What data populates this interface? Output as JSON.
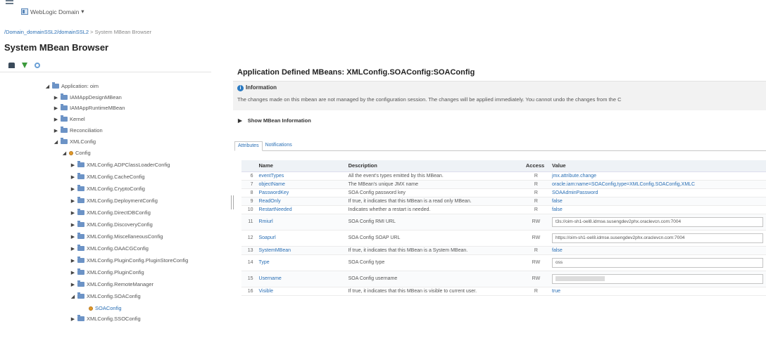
{
  "header": {
    "domain_menu": "WebLogic Domain",
    "domain_caret": "▾",
    "breadcrumb_link": "/Domain_domainSSL2/domainSSL2",
    "breadcrumb_current": " > System MBean Browser",
    "page_title": "System MBean Browser"
  },
  "tree": [
    {
      "label": "Application: oim",
      "toggle": "◢",
      "kind": "folder"
    },
    {
      "label": "IAMAppDesignMBean",
      "toggle": "▶",
      "kind": "folder"
    },
    {
      "label": "IAMAppRuntimeMBean",
      "toggle": "▶",
      "kind": "folder"
    },
    {
      "label": "Kernel",
      "toggle": "▶",
      "kind": "folder"
    },
    {
      "label": "Reconciliation",
      "toggle": "▶",
      "kind": "folder"
    },
    {
      "label": "XMLConfig",
      "toggle": "◢",
      "kind": "folder"
    },
    {
      "label": "Config",
      "toggle": "◢",
      "kind": "bean"
    },
    {
      "label": "XMLConfig.ADPClassLoaderConfig",
      "toggle": "▶",
      "kind": "folder"
    },
    {
      "label": "XMLConfig.CacheConfig",
      "toggle": "▶",
      "kind": "folder"
    },
    {
      "label": "XMLConfig.CryptoConfig",
      "toggle": "▶",
      "kind": "folder"
    },
    {
      "label": "XMLConfig.DeploymentConfig",
      "toggle": "▶",
      "kind": "folder"
    },
    {
      "label": "XMLConfig.DirectDBConfig",
      "toggle": "▶",
      "kind": "folder"
    },
    {
      "label": "XMLConfig.DiscoveryConfig",
      "toggle": "▶",
      "kind": "folder"
    },
    {
      "label": "XMLConfig.MiscellaneousConfig",
      "toggle": "▶",
      "kind": "folder"
    },
    {
      "label": "XMLConfig.OAACGConfig",
      "toggle": "▶",
      "kind": "folder"
    },
    {
      "label": "XMLConfig.PluginConfig.PluginStoreConfig",
      "toggle": "▶",
      "kind": "folder"
    },
    {
      "label": "XMLConfig.PluginConfig",
      "toggle": "▶",
      "kind": "folder"
    },
    {
      "label": "XMLConfig.RemoteManager",
      "toggle": "▶",
      "kind": "folder"
    },
    {
      "label": "XMLConfig.SOAConfig",
      "toggle": "◢",
      "kind": "folder"
    },
    {
      "label": "SOAConfig",
      "toggle": "",
      "kind": "bean"
    },
    {
      "label": "XMLConfig.SSOConfig",
      "toggle": "▶",
      "kind": "folder"
    }
  ],
  "main": {
    "title": "Application Defined MBeans: XMLConfig.SOAConfig:SOAConfig",
    "info_label": "Information",
    "info_icon": "i",
    "info_message": "The changes made on this mbean are not managed by the configuration session. The changes will be applied immediately. You cannot undo the changes from the C",
    "show_info_toggle": "▶",
    "show_info_label": "Show MBean Information",
    "tabs": [
      "Attributes",
      "Notifications"
    ]
  },
  "table": {
    "headers": [
      "",
      "Name",
      "Description",
      "Access",
      "Value"
    ],
    "rows": [
      {
        "num": "6",
        "name": "eventTypes",
        "desc": "All the event's types emitted by this MBean.",
        "access": "R",
        "value": "jmx.attribute.change",
        "editable": false
      },
      {
        "num": "7",
        "name": "objectName",
        "desc": "The MBean's unique JMX name",
        "access": "R",
        "value": "oracle.iam:name=SOAConfig,type=XMLConfig.SOAConfig,XMLC",
        "editable": false
      },
      {
        "num": "8",
        "name": "PasswordKey",
        "desc": "SOA Config password key",
        "access": "R",
        "value": "SOAAdminPassword",
        "editable": false
      },
      {
        "num": "9",
        "name": "ReadOnly",
        "desc": "If true, it indicates that this MBean is a read only MBean.",
        "access": "R",
        "value": "false",
        "editable": false
      },
      {
        "num": "10",
        "name": "RestartNeeded",
        "desc": "Indicates whether a restart is needed.",
        "access": "R",
        "value": "false",
        "editable": false
      },
      {
        "num": "11",
        "name": "Rmiurl",
        "desc": "SOA Config RMI URL",
        "access": "RW",
        "value": "t3s://oim-sh1-oel8.idmse.susengdev2phx.oraclevcn.com:7004",
        "editable": true
      },
      {
        "num": "12",
        "name": "Soapurl",
        "desc": "SOA Config SOAP URL",
        "access": "RW",
        "value": "https://oim-sh1-oel8.idmse.susengdev2phx.oraclevcn.com:7004",
        "editable": true
      },
      {
        "num": "13",
        "name": "SystemMBean",
        "desc": "If true, it indicates that this MBean is a System MBean.",
        "access": "R",
        "value": "false",
        "editable": false
      },
      {
        "num": "14",
        "name": "Type",
        "desc": "SOA Config type",
        "access": "RW",
        "value": "oss",
        "editable": true
      },
      {
        "num": "15",
        "name": "Username",
        "desc": "SOA Config username",
        "access": "RW",
        "value": "",
        "editable": true,
        "masked": true
      },
      {
        "num": "16",
        "name": "Visible",
        "desc": "If true, it indicates that this MBean is visible to current user.",
        "access": "R",
        "value": "true",
        "editable": false
      }
    ]
  }
}
